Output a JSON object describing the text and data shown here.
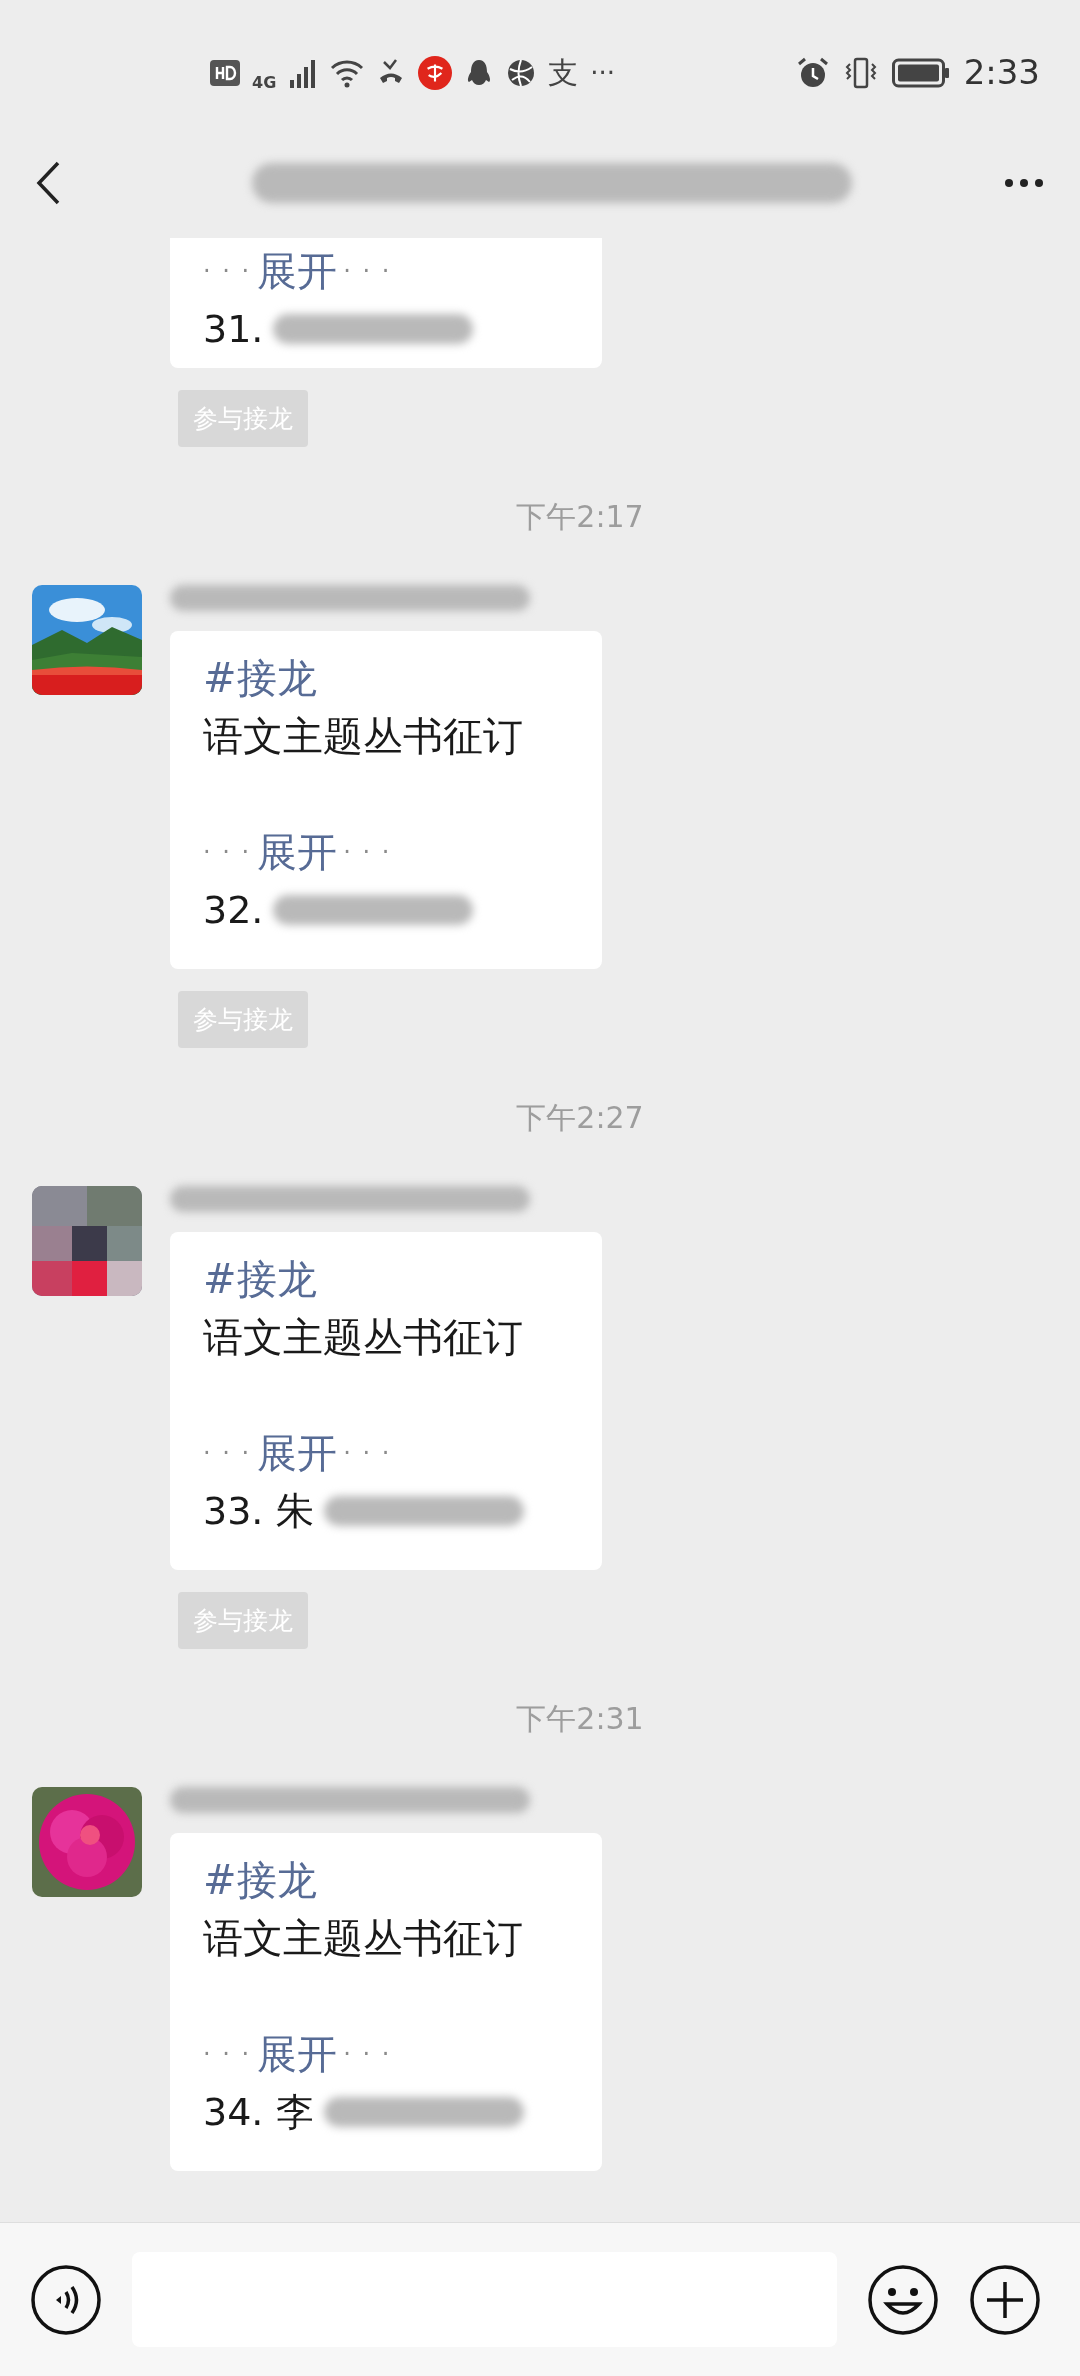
{
  "status_bar": {
    "network": "4G",
    "app_glyph": "支",
    "more": "···",
    "time": "2:33"
  },
  "messages": [
    {
      "kind": "partial",
      "expand": {
        "dots_left": "· · ·",
        "label": "展开",
        "dots_right": "· · ·"
      },
      "entry": "31.",
      "join_button": "参与接龙"
    },
    {
      "kind": "timestamp",
      "text": "下午2:17"
    },
    {
      "kind": "jielong",
      "tag": "#接龙",
      "title": "语文主题丛书征订",
      "expand": {
        "dots_left": "· · ·",
        "label": "展开",
        "dots_right": "· · ·"
      },
      "entry": "32.",
      "join_button": "参与接龙"
    },
    {
      "kind": "timestamp",
      "text": "下午2:27"
    },
    {
      "kind": "jielong",
      "tag": "#接龙",
      "title": "语文主题丛书征订",
      "expand": {
        "dots_left": "· · ·",
        "label": "展开",
        "dots_right": "· · ·"
      },
      "entry": "33. 朱",
      "join_button": "参与接龙"
    },
    {
      "kind": "timestamp",
      "text": "下午2:31"
    },
    {
      "kind": "jielong",
      "tag": "#接龙",
      "title": "语文主题丛书征订",
      "expand": {
        "dots_left": "· · ·",
        "label": "展开",
        "dots_right": "· · ·"
      },
      "entry": "34. 李"
    }
  ]
}
